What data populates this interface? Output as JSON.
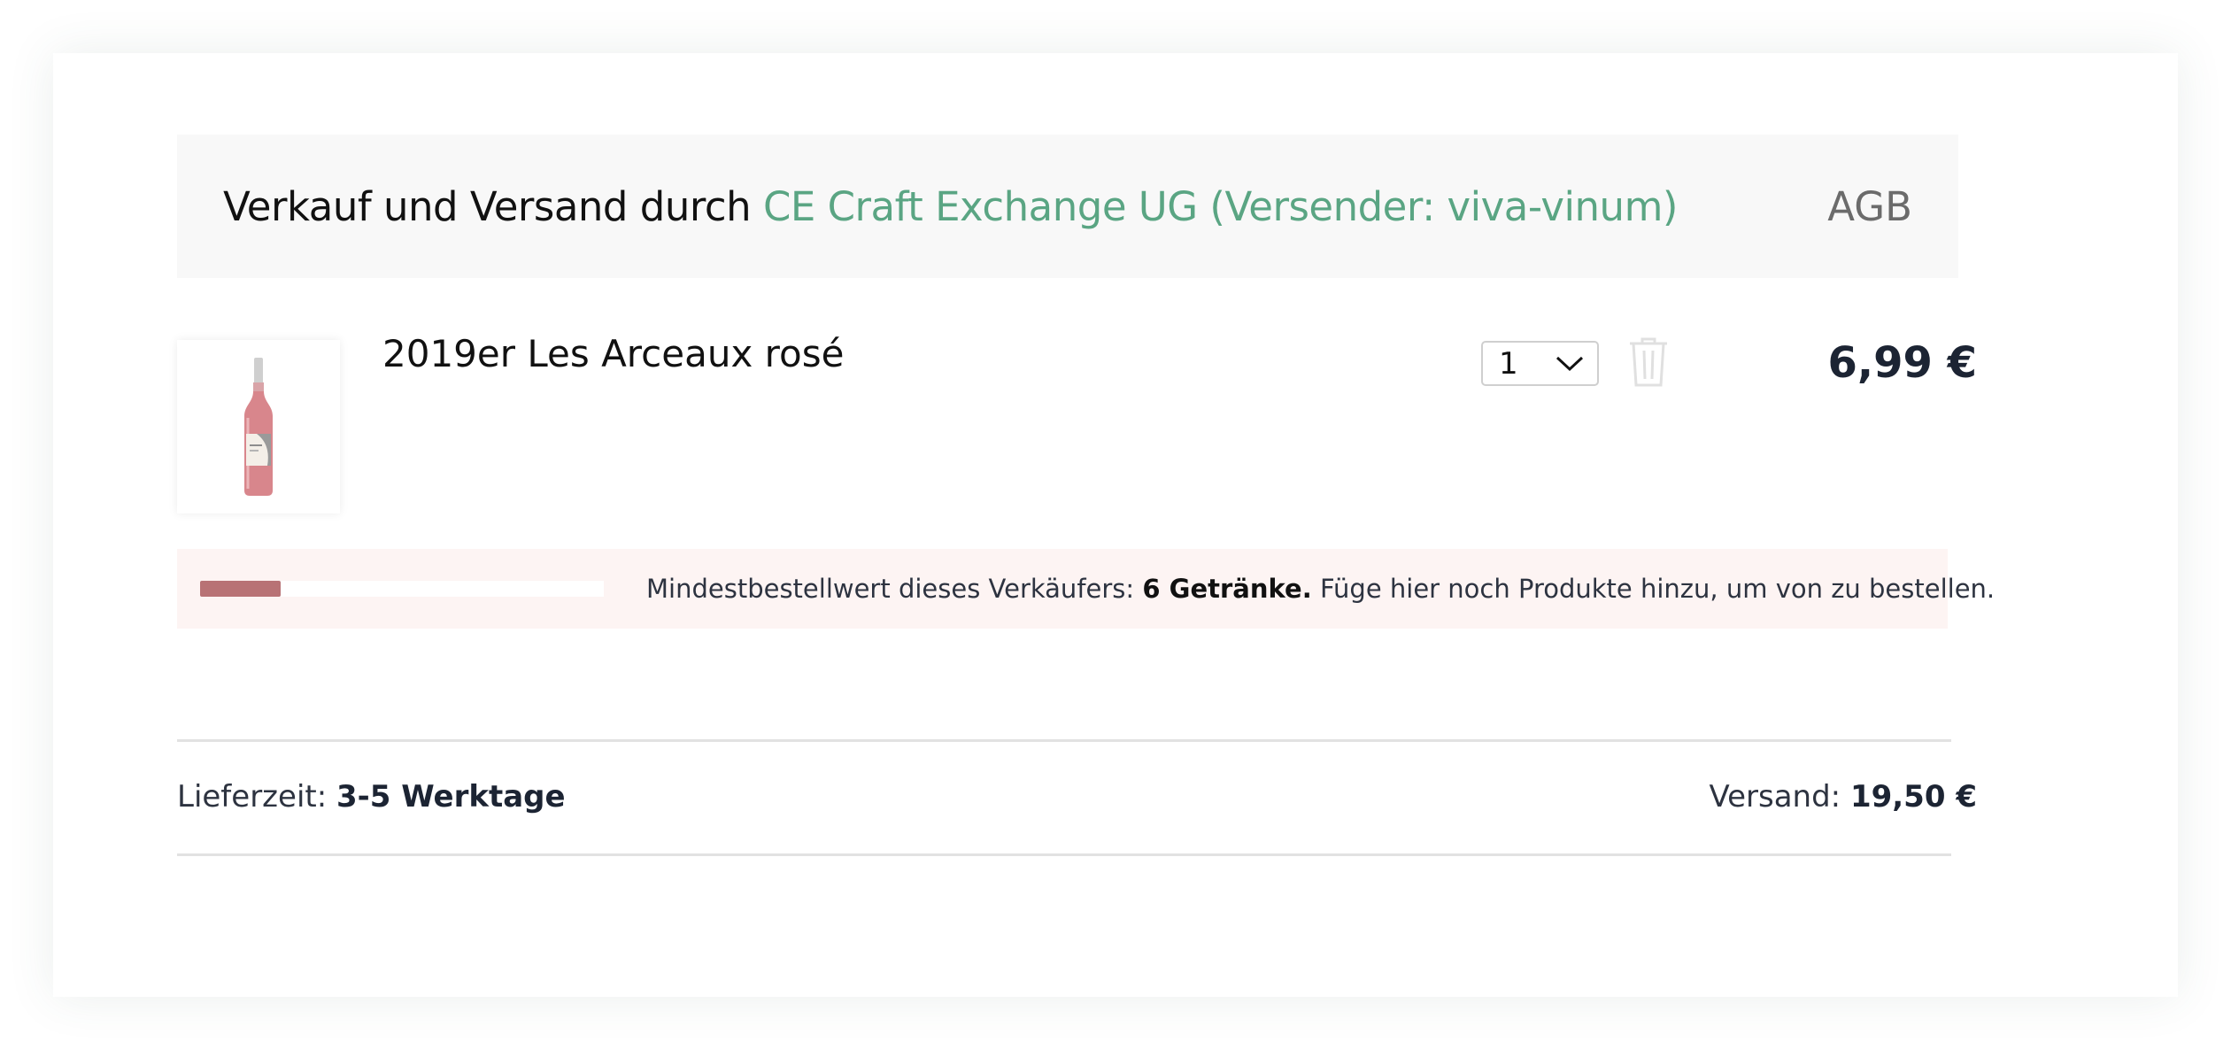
{
  "seller": {
    "prefix": "Verkauf und Versand durch",
    "name": "CE Craft Exchange UG (Versender: viva-vinum)",
    "terms_link": "AGB"
  },
  "item": {
    "name": "2019er Les Arceaux rosé",
    "image_icon": "wine-bottle-icon",
    "quantity": "1",
    "price": "6,99 €"
  },
  "min_order": {
    "progress": 0.2,
    "label": "Mindestbestellwert dieses Verkäufers:",
    "amount": "6 Getränke.",
    "hint": "Füge hier noch Produkte hinzu, um von zu bestellen."
  },
  "delivery": {
    "label": "Lieferzeit:",
    "value": "3-5 Werktage"
  },
  "shipping": {
    "label": "Versand:",
    "value": "19,50 €"
  },
  "colors": {
    "accent": "#5aa583",
    "progress_fill": "#b87275",
    "min_order_bg": "#fdf4f3",
    "header_bg": "#f8f8f8"
  }
}
